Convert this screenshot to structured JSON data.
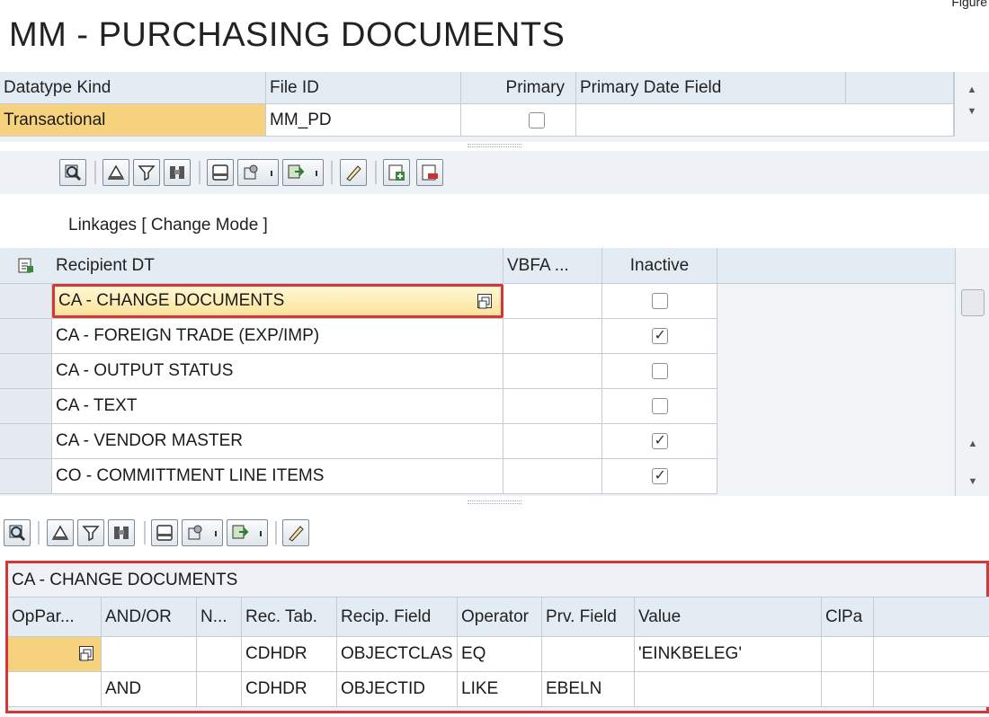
{
  "figure_label": "Figure",
  "title": "MM - PURCHASING DOCUMENTS",
  "datatype_table": {
    "columns": [
      "Datatype Kind",
      "File ID",
      "Primary",
      "Primary Date Field"
    ],
    "row": {
      "kind": "Transactional",
      "file_id": "MM_PD",
      "primary": false,
      "primary_date_field": ""
    }
  },
  "toolbar_icons": [
    "details-icon",
    "print-icon",
    "filter-icon",
    "find-icon",
    "print-preview-icon",
    "export-icon",
    "layout-icon",
    "edit-pen-icon",
    "insert-row-icon",
    "delete-row-icon"
  ],
  "linkages": {
    "label": "Linkages [ Change Mode ]",
    "columns": [
      "Recipient DT",
      "VBFA ...",
      "Inactive"
    ],
    "rows": [
      {
        "recipient": "CA - CHANGE DOCUMENTS",
        "vbfa": "",
        "inactive": false
      },
      {
        "recipient": "CA - FOREIGN TRADE (EXP/IMP)",
        "vbfa": "",
        "inactive": true
      },
      {
        "recipient": "CA - OUTPUT STATUS",
        "vbfa": "",
        "inactive": false
      },
      {
        "recipient": "CA - TEXT",
        "vbfa": "",
        "inactive": false
      },
      {
        "recipient": "CA - VENDOR MASTER",
        "vbfa": "",
        "inactive": true
      },
      {
        "recipient": "CO - COMMITTMENT LINE ITEMS",
        "vbfa": "",
        "inactive": true
      }
    ]
  },
  "conditions": {
    "title": "CA - CHANGE DOCUMENTS",
    "columns": [
      "OpPar...",
      "AND/OR",
      "N...",
      "Rec. Tab.",
      "Recip. Field",
      "Operator",
      "Prv. Field",
      "Value",
      "ClPa"
    ],
    "rows": [
      [
        "",
        "",
        "",
        "CDHDR",
        "OBJECTCLAS",
        "EQ",
        "",
        "'EINKBELEG'",
        ""
      ],
      [
        "",
        "AND",
        "",
        "CDHDR",
        "OBJECTID",
        "LIKE",
        "EBELN",
        "",
        ""
      ]
    ]
  },
  "colors": {
    "highlight_red": "#d2373a",
    "edit_yellow": "#fbe39a",
    "header_blue": "#e4ecf3"
  }
}
